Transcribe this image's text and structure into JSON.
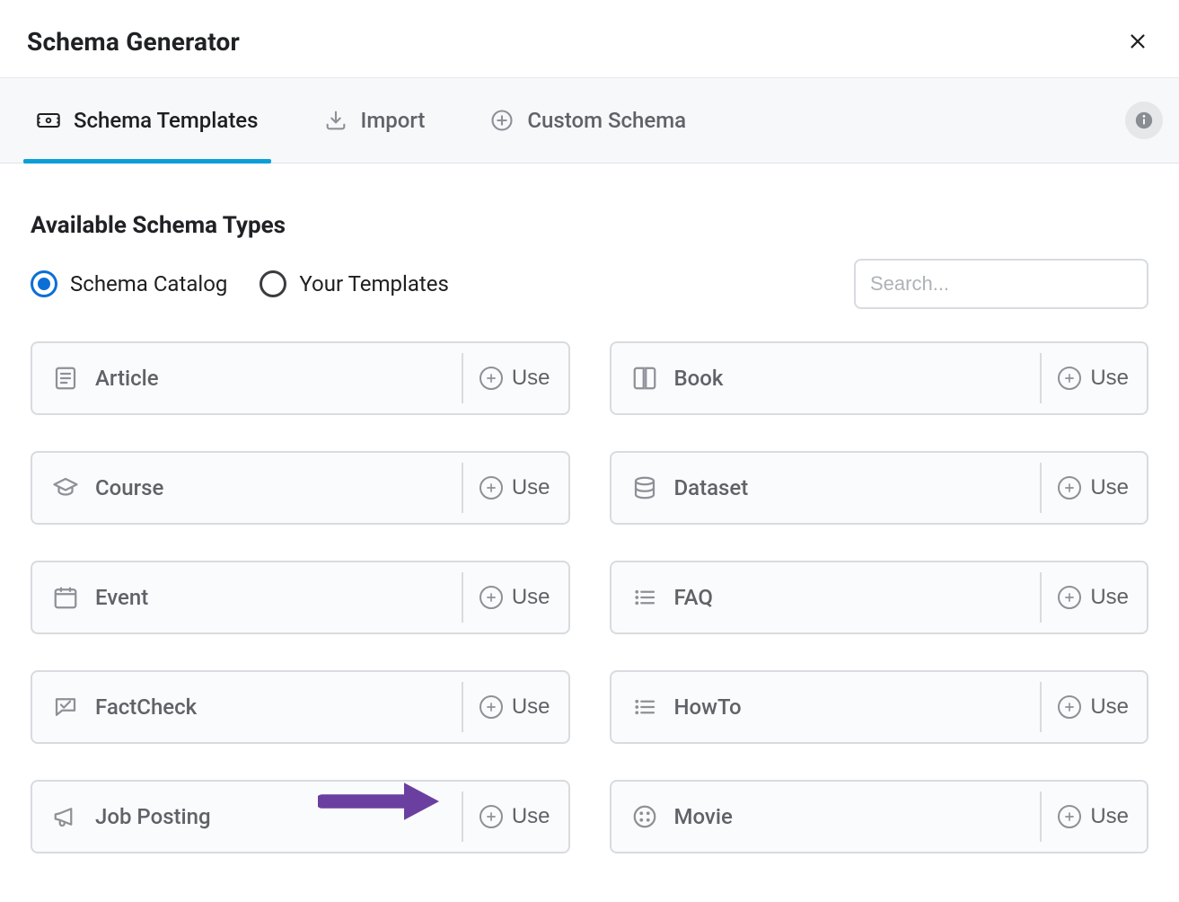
{
  "header": {
    "title": "Schema Generator"
  },
  "tabs": {
    "templates": "Schema Templates",
    "import": "Import",
    "custom": "Custom Schema",
    "active_index": 0
  },
  "section": {
    "title": "Available Schema Types"
  },
  "filters": {
    "catalog": "Schema Catalog",
    "your_templates": "Your Templates",
    "selected": "catalog"
  },
  "search": {
    "placeholder": "Search...",
    "value": ""
  },
  "actions": {
    "use": "Use"
  },
  "cards": [
    {
      "name": "Article",
      "icon": "article-icon"
    },
    {
      "name": "Book",
      "icon": "book-icon"
    },
    {
      "name": "Course",
      "icon": "course-icon"
    },
    {
      "name": "Dataset",
      "icon": "dataset-icon"
    },
    {
      "name": "Event",
      "icon": "event-icon"
    },
    {
      "name": "FAQ",
      "icon": "faq-icon"
    },
    {
      "name": "FactCheck",
      "icon": "factcheck-icon"
    },
    {
      "name": "HowTo",
      "icon": "howto-icon"
    },
    {
      "name": "Job Posting",
      "icon": "jobposting-icon"
    },
    {
      "name": "Movie",
      "icon": "movie-icon"
    }
  ],
  "icons": {
    "close": "close-icon",
    "info": "info-icon",
    "templates_tab": "ticket-icon",
    "import_tab": "download-icon",
    "custom_tab": "circle-plus-icon",
    "search": "search-icon",
    "plus": "plus-icon"
  },
  "annotation": {
    "arrow_points_to": "Job Posting Use button"
  }
}
